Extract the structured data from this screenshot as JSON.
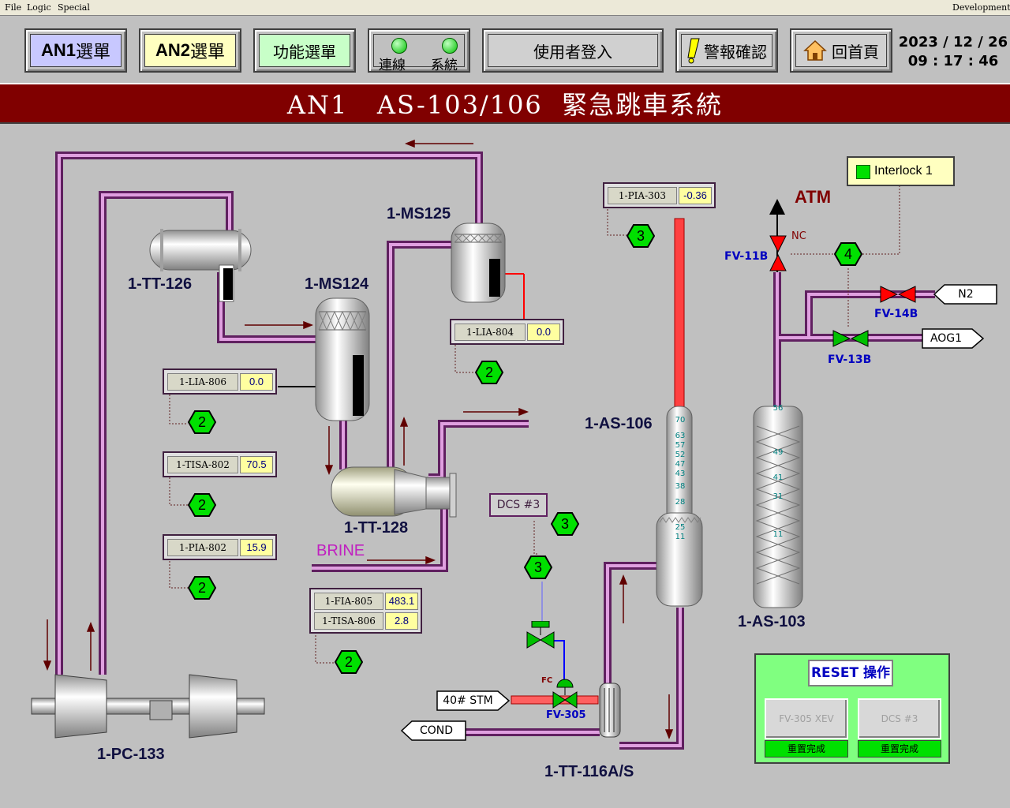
{
  "menu": {
    "file": "File",
    "logic": "Logic",
    "special": "Special",
    "development": "Development!"
  },
  "toolbar": {
    "an1_prefix": "AN1",
    "an1_suffix": " 選單",
    "an2_prefix": "AN2",
    "an2_suffix": " 選單",
    "function_menu": "功能選單",
    "connection": "連線",
    "system": "系統",
    "login": "使用者登入",
    "alarm_ack": "警報確認",
    "home": "回首頁",
    "date": "2023 / 12 / 26",
    "time": "09 : 17 : 46"
  },
  "title": "AN1   AS-103/106  緊急跳車系統",
  "equipment": {
    "tt126": "1-TT-126",
    "ms124": "1-MS124",
    "ms125": "1-MS125",
    "tt128": "1-TT-128",
    "pc133": "1-PC-133",
    "as106": "1-AS-106",
    "as103": "1-AS-103",
    "tt116": "1-TT-116A/S",
    "atm": "ATM",
    "brine": "BRINE"
  },
  "tags": {
    "lia806": {
      "name": "1-LIA-806",
      "value": "0.0"
    },
    "tisa802": {
      "name": "1-TISA-802",
      "value": "70.5"
    },
    "pia802": {
      "name": "1-PIA-802",
      "value": "15.9"
    },
    "lia804": {
      "name": "1-LIA-804",
      "value": "0.0"
    },
    "pia303": {
      "name": "1-PIA-303",
      "value": "-0.36"
    },
    "fia805": {
      "name": "1-FIA-805",
      "value": "483.1"
    },
    "tisa806": {
      "name": "1-TISA-806",
      "value": "2.8"
    }
  },
  "hexes": {
    "h2": "2",
    "h3": "3",
    "h4": "4"
  },
  "valves": {
    "fv11b": "FV-11B",
    "nc": "NC",
    "fv14b": "FV-14B",
    "fv13b": "FV-13B",
    "fv305": "FV-305",
    "fc": "FC"
  },
  "streams": {
    "n2": "N2",
    "aog1": "AOG1",
    "stm": "40# STM",
    "cond": "COND",
    "dcs3": "DCS #3"
  },
  "interlock": {
    "label": "Interlock 1",
    "color": "#00e000"
  },
  "tray_labels_106": [
    "70",
    "63",
    "57",
    "52",
    "47",
    "43",
    "38",
    "28",
    "25",
    "11"
  ],
  "tray_labels_103": [
    "56",
    "49",
    "41",
    "31",
    "11"
  ],
  "reset": {
    "title": "RESET 操作",
    "btn1": "FV-305 XEV",
    "btn2": "DCS #3",
    "status1": "重置完成",
    "status2": "重置完成"
  },
  "colors": {
    "title_bar": "#800000",
    "pipe": "#c070c0",
    "indicator_green": "#00ff00",
    "hot_pipe": "#ff4040"
  }
}
